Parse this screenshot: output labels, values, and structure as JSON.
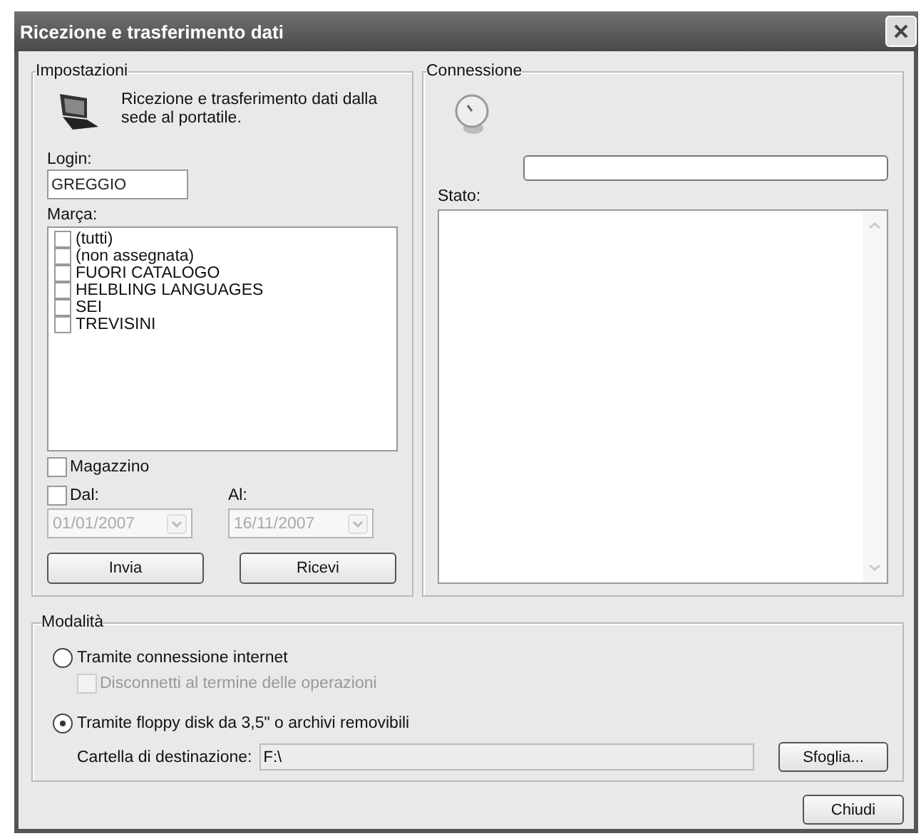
{
  "window": {
    "title": "Ricezione e trasferimento dati"
  },
  "settings": {
    "title": "Impostazioni",
    "description": "Ricezione e trasferimento dati dalla sede al portatile.",
    "login_label": "Login:",
    "login_value": "GREGGIO",
    "brand_label": "Marça:",
    "brands": [
      {
        "label": "(tutti)",
        "checked": false
      },
      {
        "label": "(non assegnata)",
        "checked": false
      },
      {
        "label": "FUORI CATALOGO",
        "checked": false
      },
      {
        "label": "HELBLING LANGUAGES",
        "checked": false
      },
      {
        "label": "SEI",
        "checked": false
      },
      {
        "label": "TREVISINI",
        "checked": false
      }
    ],
    "warehouse": {
      "label": "Magazzino",
      "checked": false
    },
    "from": {
      "label": "Dal:",
      "checked": false,
      "value": "01/01/2007",
      "disabled": true
    },
    "to": {
      "label": "Al:",
      "value": "16/11/2007",
      "disabled": true
    },
    "buttons": [
      "Invia",
      "Ricevi"
    ]
  },
  "connection": {
    "title": "Connessione",
    "progress": {
      "level": 0
    },
    "status_label": "Stato:"
  },
  "mode": {
    "title": "Modalità",
    "options": [
      {
        "label": "Tramite connessione internet",
        "selected": false,
        "sub": {
          "label": "Disconnetti al termine delle operazioni",
          "checked": false,
          "disabled": true
        }
      },
      {
        "label": "Tramite floppy disk da 3,5\" o archivi removibili",
        "selected": true
      }
    ],
    "folder_label": "Cartella di destinazione:",
    "folder_value": "F:\\",
    "browse": "Sfoglia..."
  },
  "close": "Chiudi"
}
